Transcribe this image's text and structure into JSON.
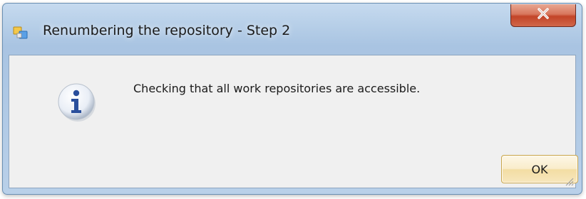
{
  "window": {
    "title": "Renumbering the repository - Step 2"
  },
  "dialog": {
    "message": "Checking that all work repositories are accessible.",
    "ok_label": "OK"
  },
  "icons": {
    "app": "repository-app-icon",
    "info": "information-icon",
    "close": "close-icon",
    "grip": "resize-grip-icon"
  },
  "colors": {
    "title_bar": "#b7cfe8",
    "close_button": "#c24428",
    "client_background": "#f0f0f0",
    "info_icon": "#2a4f9c",
    "ok_button": "#f9eccb"
  }
}
